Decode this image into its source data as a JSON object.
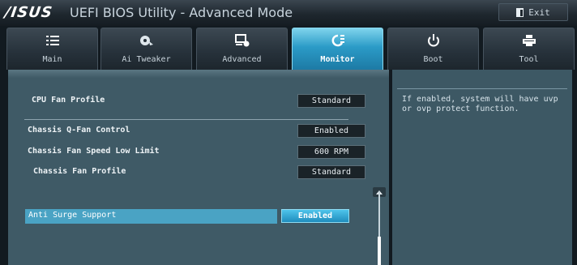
{
  "titlebar": {
    "logo": "/ISUS",
    "title": "UEFI BIOS Utility - Advanced Mode",
    "exit_label": "Exit"
  },
  "tabs": [
    {
      "label": "Main",
      "icon": "list-icon"
    },
    {
      "label": "Ai Tweaker",
      "icon": "fan-tweaker-icon"
    },
    {
      "label": "Advanced",
      "icon": "advanced-settings-icon"
    },
    {
      "label": "Monitor",
      "icon": "monitor-icon",
      "active": true
    },
    {
      "label": "Boot",
      "icon": "power-icon"
    },
    {
      "label": "Tool",
      "icon": "printer-tool-icon"
    }
  ],
  "settings": [
    {
      "label": "CPU Fan Profile",
      "value": "Standard"
    },
    {
      "label": "Chassis Q-Fan Control",
      "value": "Enabled"
    },
    {
      "label": "Chassis Fan Speed Low Limit",
      "value": "600 RPM"
    },
    {
      "label": "Chassis Fan Profile",
      "value": "Standard"
    },
    {
      "label": "Anti Surge Support",
      "value": "Enabled",
      "selected": true
    }
  ],
  "help": {
    "text": "If enabled, system will have uvp or ovp protect function."
  },
  "colors": {
    "accent": "#2b9bc7",
    "panel": "#3f5a66",
    "selection": "#4aa3c4"
  }
}
